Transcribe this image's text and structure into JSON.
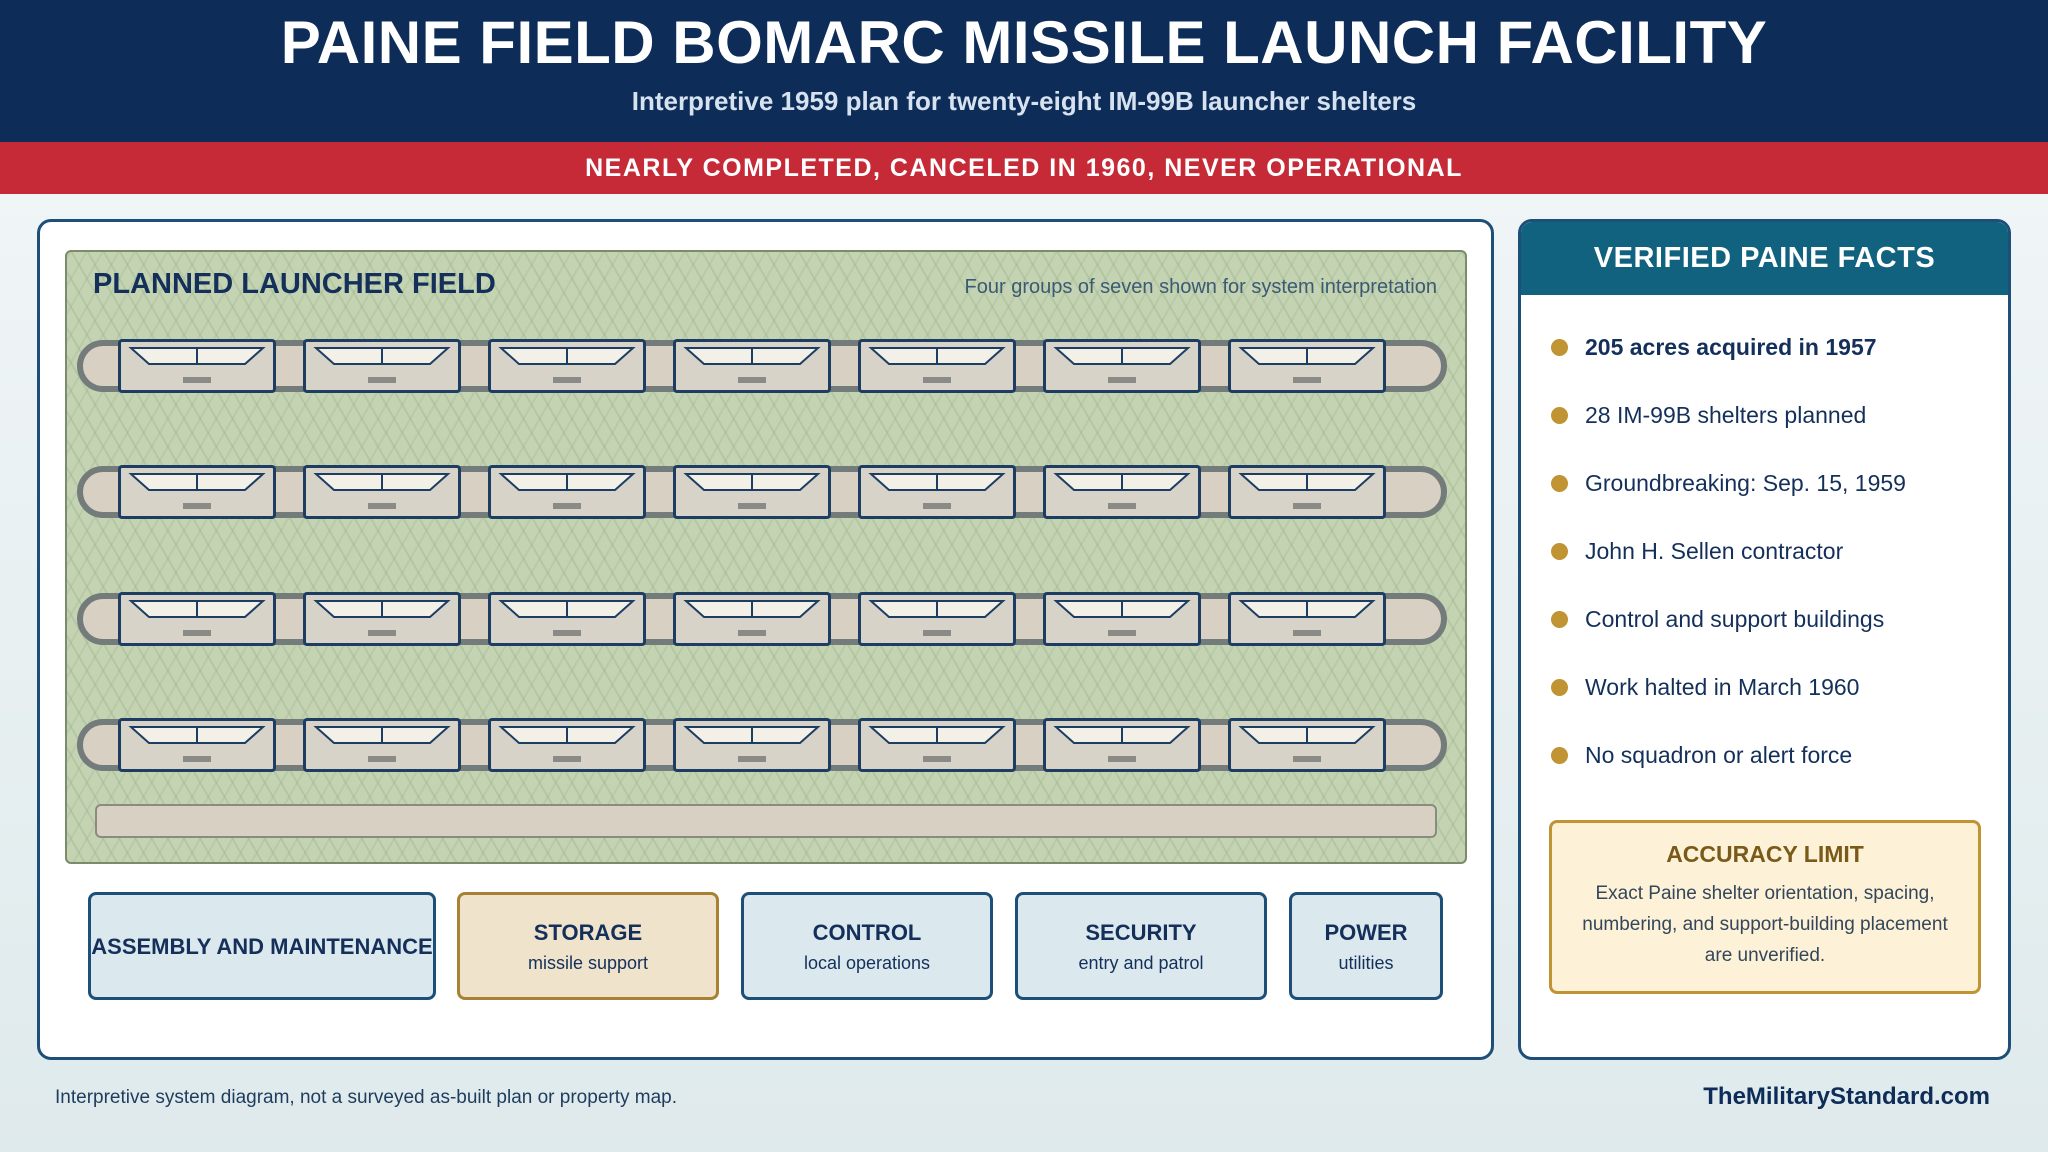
{
  "header": {
    "title": "PAINE FIELD BOMARC MISSILE LAUNCH FACILITY",
    "subtitle": "Interpretive 1959 plan for twenty-eight IM-99B launcher shelters"
  },
  "banner": "NEARLY COMPLETED, CANCELED IN 1960, NEVER OPERATIONAL",
  "field": {
    "title": "PLANNED LAUNCHER FIELD",
    "note": "Four groups of seven shown for system interpretation",
    "rows": 4,
    "shelters_per_row": 7
  },
  "units": [
    {
      "title": "ASSEMBLY AND MAINTENANCE",
      "sub": ""
    },
    {
      "title": "STORAGE",
      "sub": "missile support"
    },
    {
      "title": "CONTROL",
      "sub": "local operations"
    },
    {
      "title": "SECURITY",
      "sub": "entry and patrol"
    },
    {
      "title": "POWER",
      "sub": "utilities"
    }
  ],
  "facts": {
    "title": "VERIFIED PAINE FACTS",
    "items": [
      "205 acres acquired in 1957",
      "28 IM-99B shelters planned",
      "Groundbreaking: Sep. 15, 1959",
      "John H. Sellen contractor",
      "Control and support buildings",
      "Work halted in March 1960",
      "No squadron or alert force"
    ]
  },
  "limit": {
    "title": "ACCURACY LIMIT",
    "text": "Exact Paine shelter orientation, spacing, numbering, and support-building placement are unverified."
  },
  "footer": {
    "note": "Interpretive system diagram, not a surveyed as-built plan or property map.",
    "brand": "TheMilitaryStandard.com"
  },
  "colors": {
    "navy": "#0d2d58",
    "red": "#c62a37",
    "teal": "#11627f",
    "field_green": "#c4d3b2",
    "gold": "#c09432"
  }
}
